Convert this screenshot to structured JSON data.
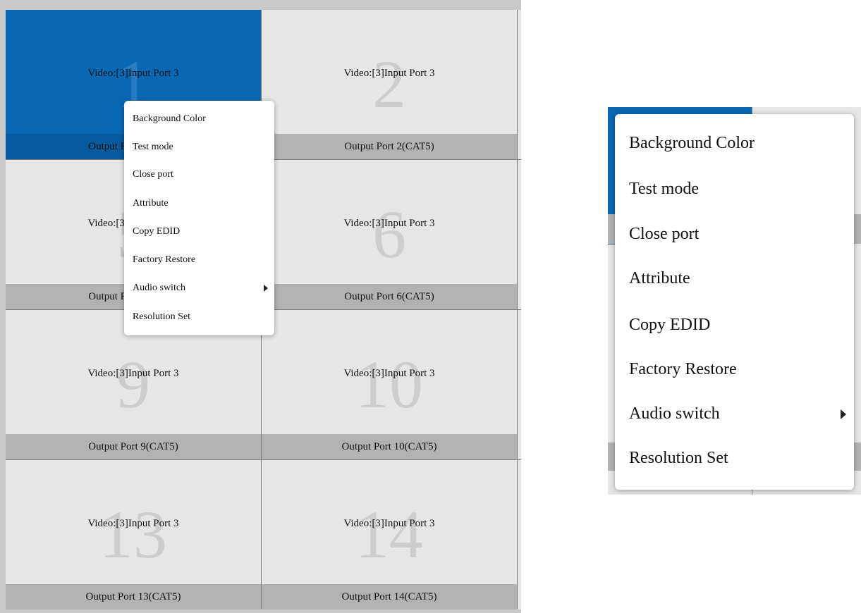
{
  "grid": {
    "cells": [
      {
        "number": "1",
        "video": "Video:[3]Input Port 3",
        "output": "Output Port 1(CAT5)",
        "selected": true
      },
      {
        "number": "2",
        "video": "Video:[3]Input Port 3",
        "output": "Output Port 2(CAT5)",
        "selected": false
      },
      {
        "number": "5",
        "video": "Video:[3]Input Port 3",
        "output": "Output Port 5(CAT5)",
        "selected": false
      },
      {
        "number": "6",
        "video": "Video:[3]Input Port 3",
        "output": "Output Port 6(CAT5)",
        "selected": false
      },
      {
        "number": "9",
        "video": "Video:[3]Input Port 3",
        "output": "Output Port 9(CAT5)",
        "selected": false
      },
      {
        "number": "10",
        "video": "Video:[3]Input Port 3",
        "output": "Output Port 10(CAT5)",
        "selected": false
      },
      {
        "number": "13",
        "video": "Video:[3]Input Port 3",
        "output": "Output Port 13(CAT5)",
        "selected": false
      },
      {
        "number": "14",
        "video": "Video:[3]Input Port 3",
        "output": "Output Port 14(CAT5)",
        "selected": false
      }
    ]
  },
  "context_menu": {
    "items": [
      {
        "label": "Background Color",
        "has_submenu": false
      },
      {
        "label": "Test mode",
        "has_submenu": false
      },
      {
        "label": "Close port",
        "has_submenu": false
      },
      {
        "label": "Attribute",
        "has_submenu": false
      },
      {
        "label": "Copy EDID",
        "has_submenu": false
      },
      {
        "label": "Factory Restore",
        "has_submenu": false
      },
      {
        "label": "Audio switch",
        "has_submenu": true,
        "submenu_icon": "caret-right-icon"
      },
      {
        "label": "Resolution Set",
        "has_submenu": false
      }
    ]
  },
  "colors": {
    "selected_cell": "#0868b4",
    "cell": "#e6e6e6",
    "footer": "#b2b2b2"
  }
}
